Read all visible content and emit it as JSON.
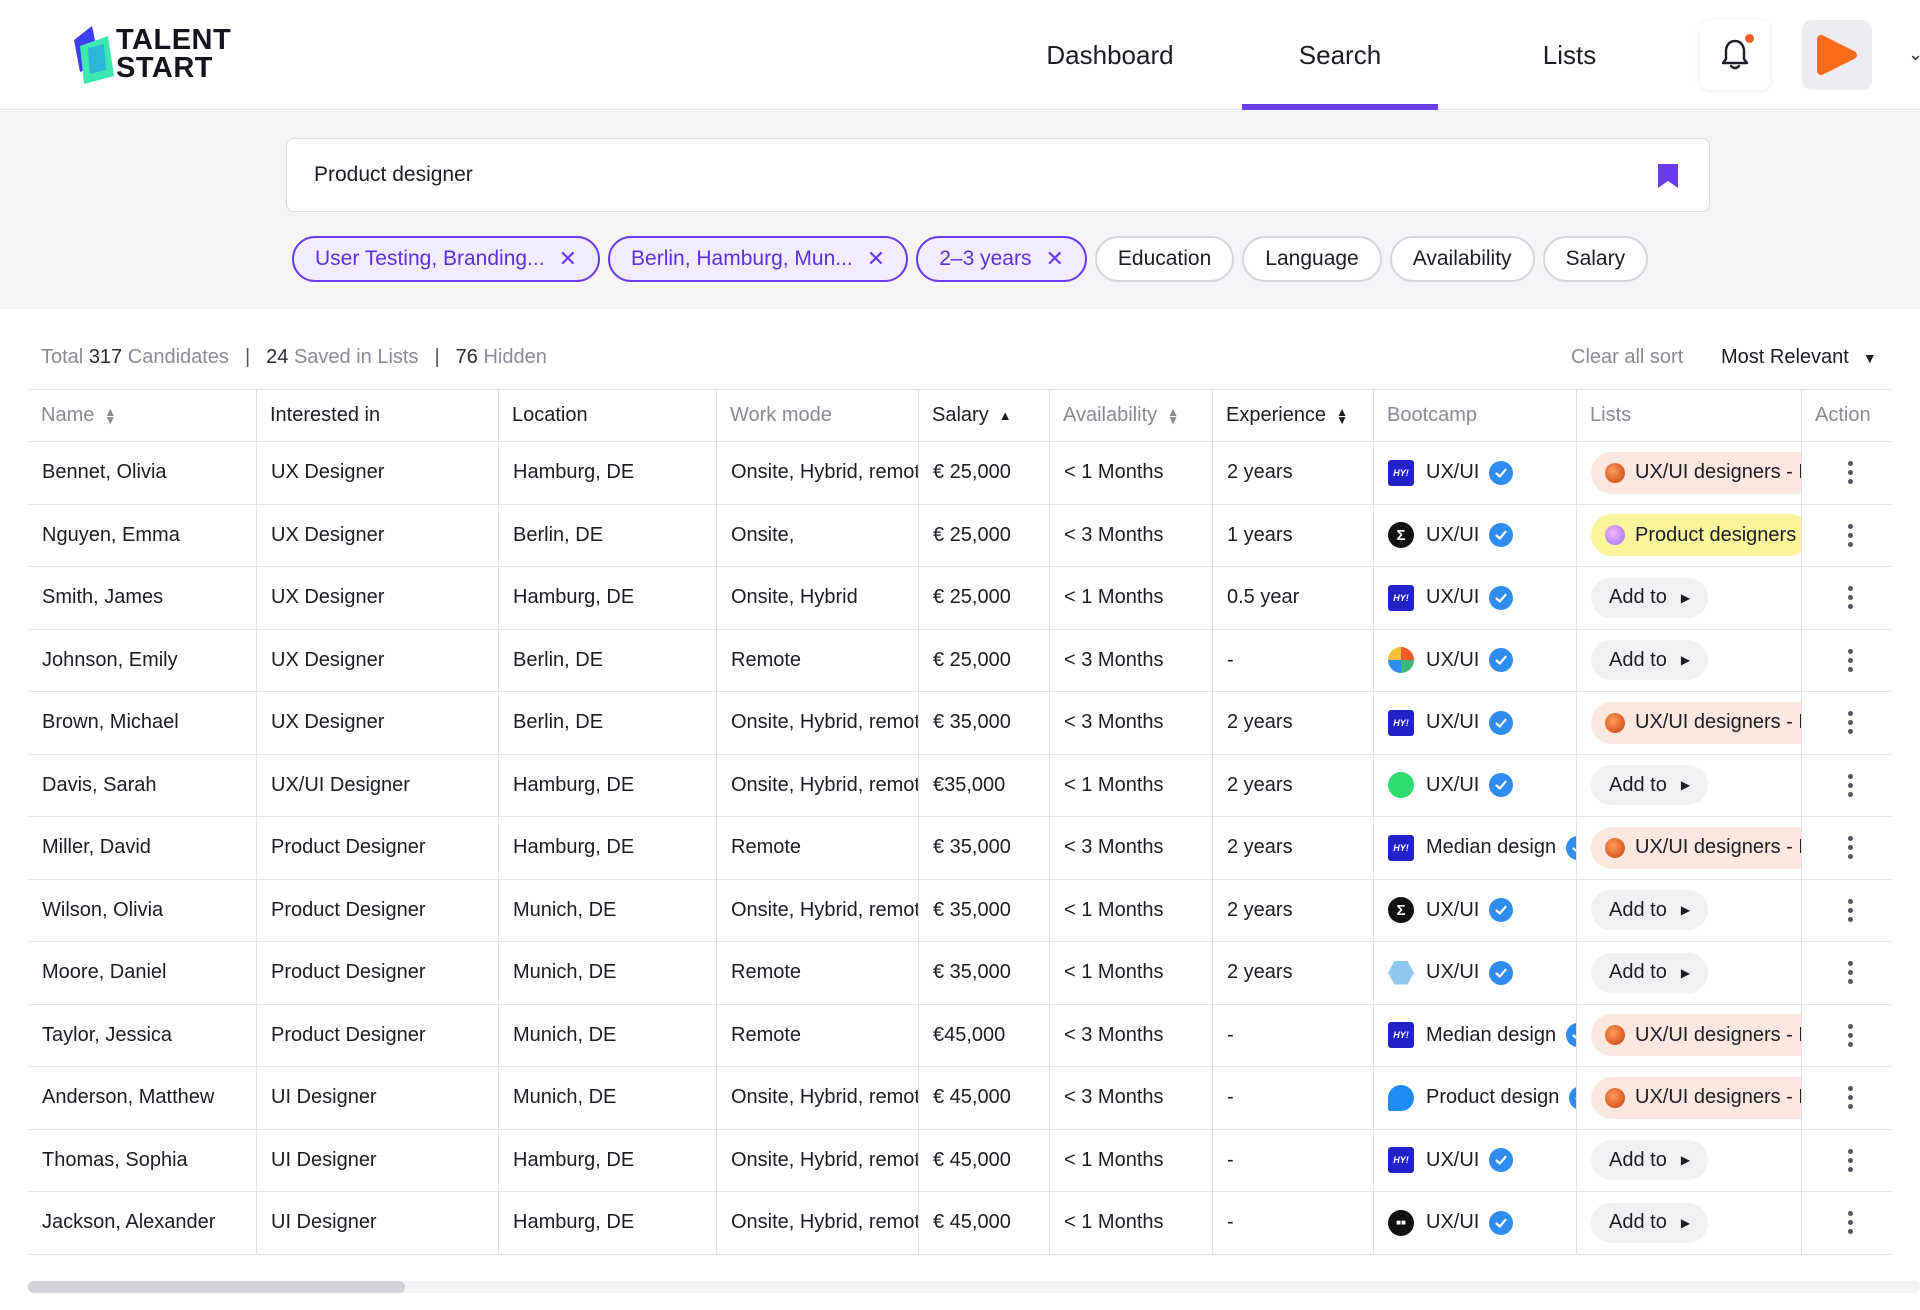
{
  "brand": {
    "line1": "TALENT",
    "line2": "START"
  },
  "nav": {
    "tabs": [
      {
        "label": "Dashboard",
        "active": false
      },
      {
        "label": "Search",
        "active": true
      },
      {
        "label": "Lists",
        "active": false
      }
    ]
  },
  "search": {
    "value": "Product designer"
  },
  "filters": [
    {
      "label": "User Testing, Branding...",
      "selected": true
    },
    {
      "label": "Berlin, Hamburg, Mun...",
      "selected": true
    },
    {
      "label": "2–3 years",
      "selected": true
    },
    {
      "label": "Education",
      "selected": false
    },
    {
      "label": "Language",
      "selected": false
    },
    {
      "label": "Availability",
      "selected": false
    },
    {
      "label": "Salary",
      "selected": false
    }
  ],
  "summary": {
    "total_label": "Total",
    "total_count": "317",
    "candidates_label": "Candidates",
    "saved_count": "24",
    "saved_label": "Saved in Lists",
    "hidden_count": "76",
    "hidden_label": "Hidden",
    "clear_sort": "Clear all sort",
    "sort_value": "Most Relevant"
  },
  "columns": [
    "Name",
    "Interested in",
    "Location",
    "Work mode",
    "Salary",
    "Availability",
    "Experience",
    "Bootcamp",
    "Lists",
    "Action"
  ],
  "add_to_label": "Add to",
  "colors": {
    "accent": "#6a3cf0",
    "verified": "#2f8cf0",
    "peach": "#fde8e0",
    "yellow": "#fbf59c"
  },
  "rows": [
    {
      "name": "Bennet, Olivia",
      "interest": "UX Designer",
      "location": "Hamburg, DE",
      "work": "Onsite, Hybrid, remote",
      "salary": "€ 25,000",
      "avail": "< 1 Months",
      "exp": "2 years",
      "boot_logo": "hy",
      "boot": "UX/UI",
      "list": {
        "type": "peach",
        "label": "UX/UI designers - Berlin"
      }
    },
    {
      "name": "Nguyen, Emma",
      "interest": "UX Designer",
      "location": "Berlin, DE",
      "work": "Onsite,",
      "salary": "€ 25,000",
      "avail": "< 3 Months",
      "exp": "1 years",
      "boot_logo": "sigma",
      "boot": "UX/UI",
      "list": {
        "type": "yellow",
        "label": "Product designers"
      }
    },
    {
      "name": "Smith, James",
      "interest": "UX Designer",
      "location": "Hamburg, DE",
      "work": "Onsite, Hybrid",
      "salary": "€ 25,000",
      "avail": "< 1 Months",
      "exp": "0.5 year",
      "boot_logo": "hy",
      "boot": "UX/UI",
      "list": {
        "type": "add",
        "label": ""
      }
    },
    {
      "name": "Johnson, Emily",
      "interest": "UX Designer",
      "location": "Berlin, DE",
      "work": "Remote",
      "salary": "€ 25,000",
      "avail": "< 3 Months",
      "exp": "-",
      "boot_logo": "multi",
      "boot": "UX/UI",
      "list": {
        "type": "add",
        "label": ""
      }
    },
    {
      "name": "Brown, Michael",
      "interest": "UX Designer",
      "location": "Berlin, DE",
      "work": "Onsite, Hybrid, remote",
      "salary": "€ 35,000",
      "avail": "< 3 Months",
      "exp": "2 years",
      "boot_logo": "hy",
      "boot": "UX/UI",
      "list": {
        "type": "peach",
        "label": "UX/UI designers - Berlin"
      }
    },
    {
      "name": "Davis, Sarah",
      "interest": "UX/UI Designer",
      "location": "Hamburg, DE",
      "work": "Onsite, Hybrid, remote",
      "salary": "€35,000",
      "avail": "< 1 Months",
      "exp": "2 years",
      "boot_logo": "green",
      "boot": "UX/UI",
      "list": {
        "type": "add",
        "label": ""
      }
    },
    {
      "name": "Miller, David",
      "interest": "Product Designer",
      "location": "Hamburg, DE",
      "work": "Remote",
      "salary": "€ 35,000",
      "avail": "< 3 Months",
      "exp": "2 years",
      "boot_logo": "hy",
      "boot": "Median design",
      "list": {
        "type": "peach",
        "label": "UX/UI designers - Berlin"
      }
    },
    {
      "name": "Wilson, Olivia",
      "interest": "Product Designer",
      "location": "Munich, DE",
      "work": "Onsite, Hybrid, remote",
      "salary": "€ 35,000",
      "avail": "< 1 Months",
      "exp": "2 years",
      "boot_logo": "sigma",
      "boot": "UX/UI",
      "list": {
        "type": "add",
        "label": ""
      }
    },
    {
      "name": "Moore, Daniel",
      "interest": "Product Designer",
      "location": "Munich, DE",
      "work": "Remote",
      "salary": "€ 35,000",
      "avail": "< 1 Months",
      "exp": "2 years",
      "boot_logo": "hex",
      "boot": "UX/UI",
      "list": {
        "type": "add",
        "label": ""
      }
    },
    {
      "name": "Taylor, Jessica",
      "interest": "Product Designer",
      "location": "Munich, DE",
      "work": "Remote",
      "salary": "€45,000",
      "avail": "< 3 Months",
      "exp": "-",
      "boot_logo": "hy",
      "boot": "Median design",
      "list": {
        "type": "peach",
        "label": "UX/UI designers - Berlin"
      }
    },
    {
      "name": "Anderson, Matthew",
      "interest": "UI Designer",
      "location": "Munich, DE",
      "work": "Onsite, Hybrid, remote",
      "salary": "€ 45,000",
      "avail": "< 3 Months",
      "exp": "-",
      "boot_logo": "blue",
      "boot": "Product design",
      "list": {
        "type": "peach",
        "label": "UX/UI designers - Berlin"
      }
    },
    {
      "name": "Thomas, Sophia",
      "interest": "UI Designer",
      "location": "Hamburg, DE",
      "work": "Onsite, Hybrid, remote",
      "salary": "€ 45,000",
      "avail": "< 1 Months",
      "exp": "-",
      "boot_logo": "hy",
      "boot": "UX/UI",
      "list": {
        "type": "add",
        "label": ""
      }
    },
    {
      "name": "Jackson, Alexander",
      "interest": "UI Designer",
      "location": "Hamburg, DE",
      "work": "Onsite, Hybrid, remote",
      "salary": "€ 45,000",
      "avail": "< 1 Months",
      "exp": "-",
      "boot_logo": "dark",
      "boot": "UX/UI",
      "list": {
        "type": "add",
        "label": ""
      }
    }
  ]
}
